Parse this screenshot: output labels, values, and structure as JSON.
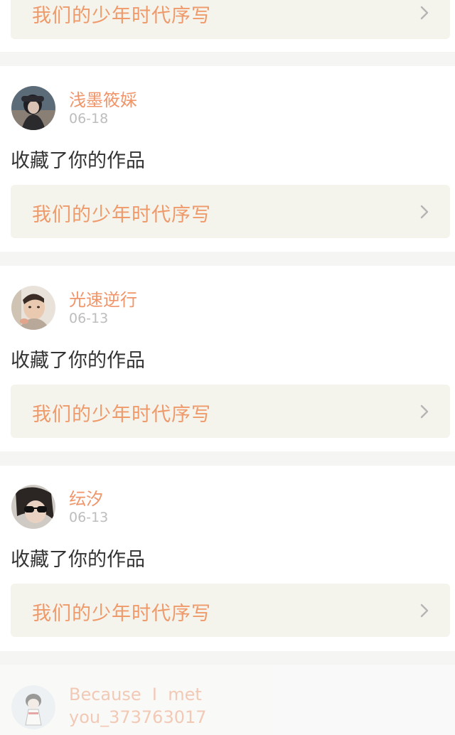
{
  "items": [
    {
      "username": "",
      "date": "",
      "action": "",
      "work_title": "我们的少年时代序写"
    },
    {
      "username": "浅墨筱婇",
      "date": "06-18",
      "action": "收藏了你的作品",
      "work_title": "我们的少年时代序写",
      "icon": "chevron-right-icon"
    },
    {
      "username": "光速逆行",
      "date": "06-13",
      "action": "收藏了你的作品",
      "work_title": "我们的少年时代序写",
      "icon": "chevron-right-icon"
    },
    {
      "username": "纭汐",
      "date": "06-13",
      "action": "收藏了你的作品",
      "work_title": "我们的少年时代序写",
      "icon": "chevron-right-icon"
    },
    {
      "username": "Because I met you_373763017",
      "username_line1": "Because  I  met",
      "username_line2": "you_373763017"
    }
  ],
  "colors": {
    "username": "#f0956a",
    "date": "#bdbdbd",
    "action": "#333333",
    "work_link_bg": "#f4f3ec",
    "separator": "#f5f5f4"
  }
}
